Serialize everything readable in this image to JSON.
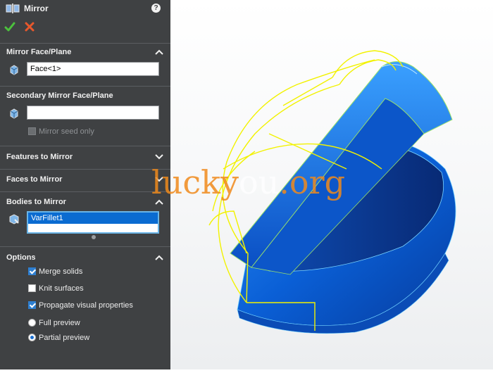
{
  "header": {
    "title": "Mirror",
    "help": "?"
  },
  "actions": {
    "ok_icon": "check-icon",
    "cancel_icon": "x-icon"
  },
  "sections": {
    "mirror_face_plane": {
      "title": "Mirror Face/Plane",
      "value": "Face<1>"
    },
    "secondary_mirror": {
      "title": "Secondary Mirror Face/Plane",
      "value": "",
      "seed_label": "Mirror seed only"
    },
    "features_to_mirror": {
      "title": "Features to Mirror"
    },
    "faces_to_mirror": {
      "title": "Faces to Mirror"
    },
    "bodies_to_mirror": {
      "title": "Bodies to Mirror",
      "value": "VarFillet1"
    },
    "options": {
      "title": "Options",
      "merge_solids": "Merge solids",
      "knit_surfaces": "Knit surfaces",
      "propagate": "Propagate visual properties",
      "full_preview": "Full preview",
      "partial_preview": "Partial preview"
    }
  },
  "state": {
    "merge_solids": true,
    "knit_surfaces": false,
    "propagate": true,
    "mirror_seed_only": false,
    "preview": "partial"
  },
  "watermark": {
    "part1": "lucky",
    "part2": "ou",
    "part3": ".org"
  },
  "colors": {
    "panel": "#3f4143",
    "accent": "#2e7fd1",
    "model_blue": "#1a73e6",
    "preview_yellow": "#f2f200"
  }
}
